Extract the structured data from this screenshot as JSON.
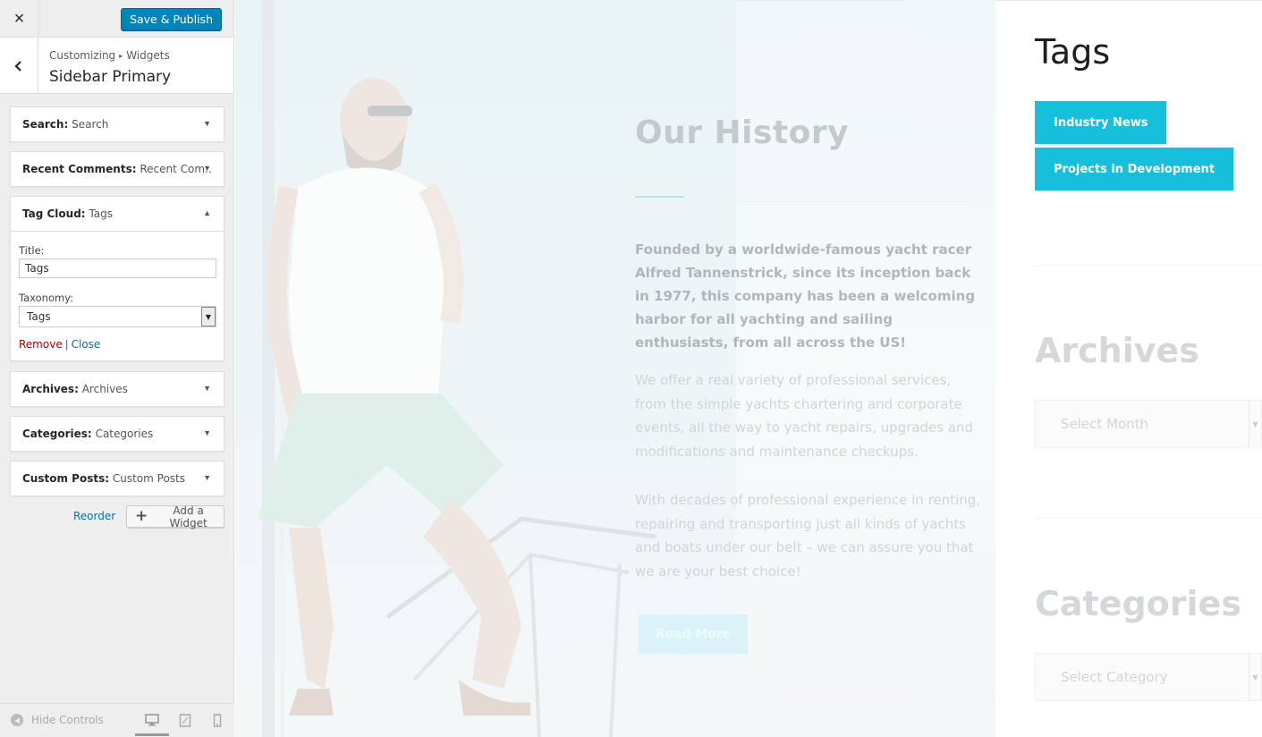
{
  "customizer": {
    "close_icon": "×",
    "publish_label": "Save & Publish",
    "back_icon": "‹",
    "breadcrumb": {
      "root": "Customizing",
      "sep": "▸",
      "current": "Widgets"
    },
    "section_title": "Sidebar Primary",
    "widgets": [
      {
        "type": "Search:",
        "name": "Search",
        "expanded": false
      },
      {
        "type": "Recent Comments:",
        "name": "Recent Com...",
        "expanded": false
      },
      {
        "type": "Tag Cloud:",
        "name": "Tags",
        "expanded": true
      },
      {
        "type": "Archives:",
        "name": "Archives",
        "expanded": false
      },
      {
        "type": "Categories:",
        "name": "Categories",
        "expanded": false
      },
      {
        "type": "Custom Posts:",
        "name": "Custom Posts",
        "expanded": false
      }
    ],
    "tag_cloud_form": {
      "title_label": "Title:",
      "title_value": "Tags",
      "taxonomy_label": "Taxonomy:",
      "taxonomy_value": "Tags",
      "remove_label": "Remove",
      "divider": "|",
      "close_label": "Close"
    },
    "reorder_label": "Reorder",
    "add_widget_label": "Add a Widget",
    "hide_controls_label": "Hide Controls",
    "devices": [
      "desktop",
      "tablet",
      "mobile"
    ],
    "active_device": "desktop"
  },
  "preview": {
    "history": {
      "title": "Our History",
      "lead": "Founded by a worldwide-famous yacht racer Alfred Tannenstrick, since its inception back in 1977, this company has been a welcoming harbor for all yachting and sailing enthusiasts, from all across the US!",
      "para1": "We offer a real variety of professional services, from the simple yachts chartering and corporate events, all the way to yacht repairs, upgrades and modifications and maintenance checkups.",
      "para2": "With decades of professional experience in renting, repairing and transporting just all kinds of yachts and boats under our belt – we can assure you that we are your best choice!",
      "read_more": "Read More"
    },
    "sidebar": {
      "tags_title": "Tags",
      "tags": [
        "Industry News",
        "Projects in Development"
      ],
      "archives_title": "Archives",
      "archives_select": "Select Month",
      "categories_title": "Categories",
      "categories_select": "Select Category"
    }
  },
  "colors": {
    "wp_blue": "#0085ba",
    "tag_cyan": "#16c0dc",
    "remove_red": "#aa0000",
    "link_blue": "#0073aa"
  }
}
